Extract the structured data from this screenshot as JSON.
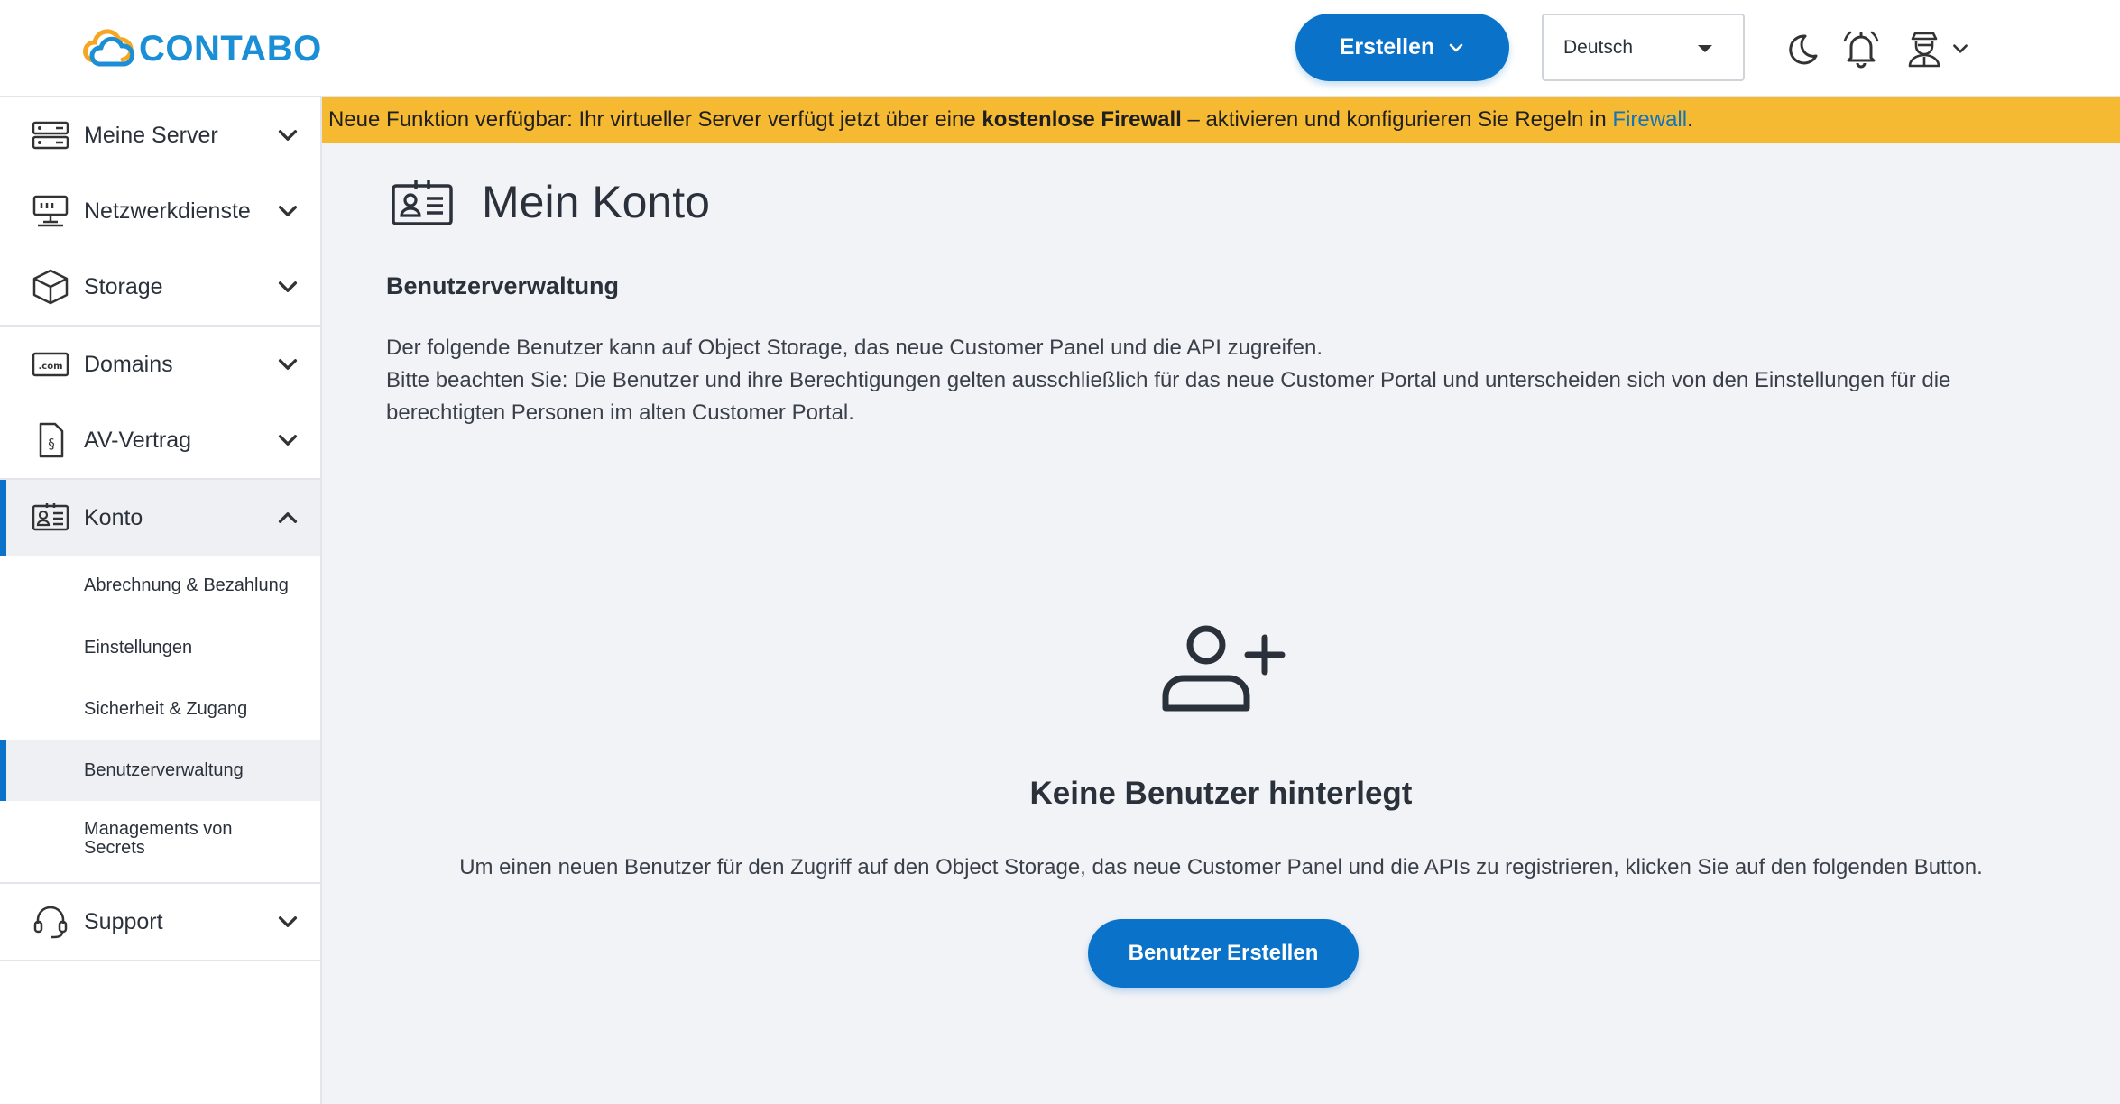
{
  "header": {
    "logo_text": "CONTABO",
    "create_button": "Erstellen",
    "language": "Deutsch",
    "icons": [
      "moon-icon",
      "bell-icon",
      "user-avatar-icon",
      "chevron-down-icon"
    ]
  },
  "banner": {
    "text_before": "Neue Funktion verfügbar: Ihr virtueller Server verfügt jetzt über eine ",
    "bold": "kostenlose Firewall",
    "text_middle": " – aktivieren und konfigurieren Sie Regeln in ",
    "link": "Firewall",
    "text_after": "."
  },
  "sidebar": {
    "items": [
      {
        "label": "Meine Server",
        "icon": "server-icon"
      },
      {
        "label": "Netzwerkdienste",
        "icon": "network-icon"
      },
      {
        "label": "Storage",
        "icon": "box-icon"
      },
      {
        "label": "Domains",
        "icon": "domain-icon"
      },
      {
        "label": "AV-Vertrag",
        "icon": "contract-icon"
      },
      {
        "label": "Konto",
        "icon": "id-card-icon"
      },
      {
        "label": "Support",
        "icon": "headset-icon"
      }
    ],
    "konto_sub": [
      "Abrechnung & Bezahlung",
      "Einstellungen",
      "Sicherheit & Zugang",
      "Benutzerverwaltung",
      "Managements von Secrets"
    ]
  },
  "main": {
    "title": "Mein Konto",
    "section_title": "Benutzerverwaltung",
    "desc_line1": "Der folgende Benutzer kann auf Object Storage, das neue Customer Panel und die API zugreifen.",
    "desc_line2": "Bitte beachten Sie: Die Benutzer und ihre Berechtigungen gelten ausschließlich für das neue Customer Portal und unterscheiden sich von den Einstellungen für die berechtigten Personen im alten Customer Portal.",
    "empty_title": "Keine Benutzer hinterlegt",
    "empty_text": "Um einen neuen Benutzer für den Zugriff auf den Object Storage, das neue Customer Panel und die APIs zu registrieren, klicken Sie auf den folgenden Button.",
    "create_user_button": "Benutzer Erstellen"
  },
  "colors": {
    "accent": "#0a73c9",
    "banner": "#f6b932",
    "logo": "#1b8fd6"
  }
}
